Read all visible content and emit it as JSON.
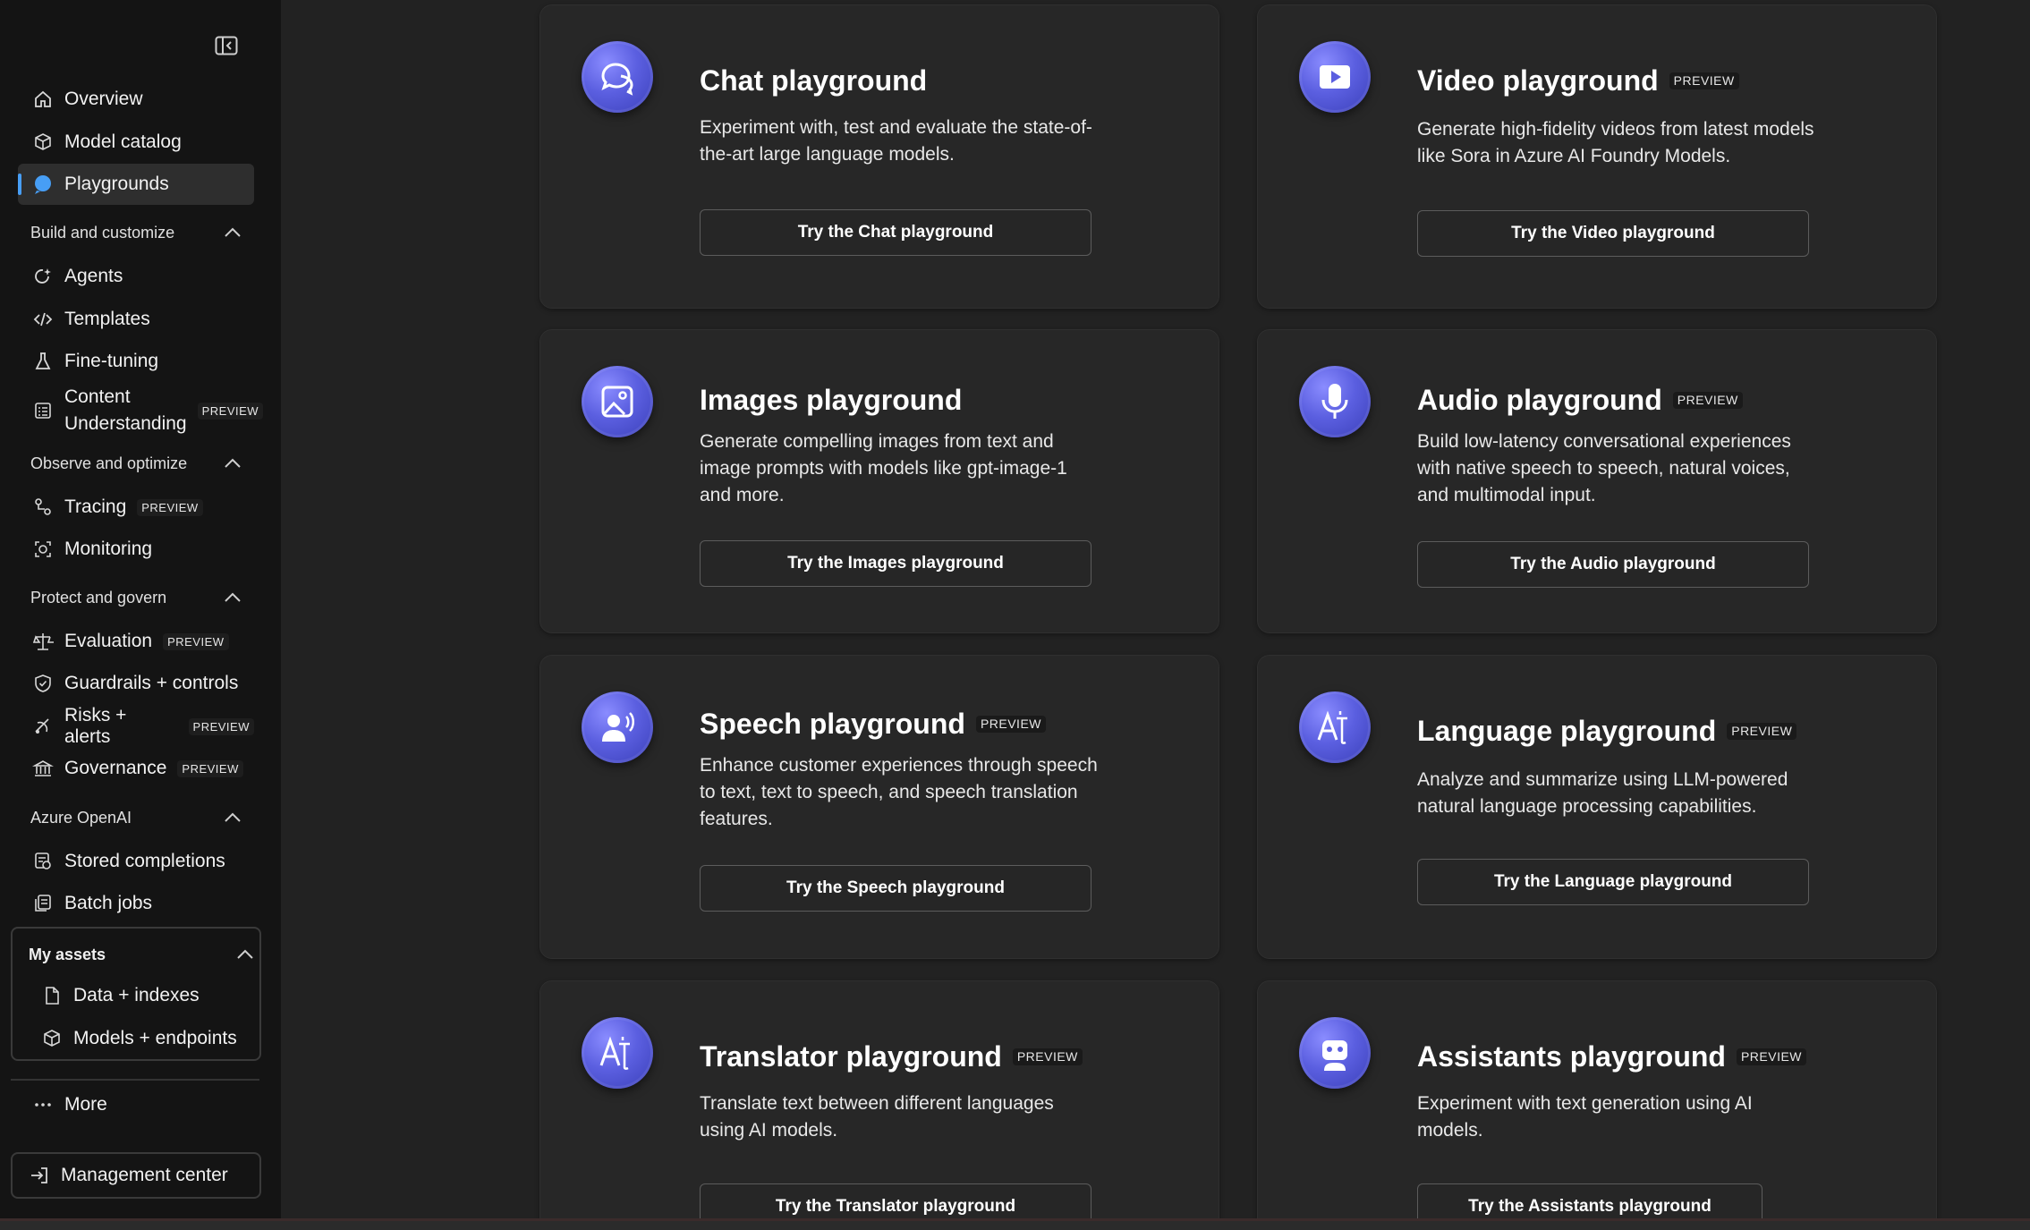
{
  "sidebar": {
    "collapse_icon": "panel-collapse-icon",
    "overview": "Overview",
    "model_catalog": "Model catalog",
    "playgrounds": "Playgrounds",
    "sections": {
      "build": "Build and customize",
      "observe": "Observe and optimize",
      "protect": "Protect and govern",
      "azure_openai": "Azure OpenAI",
      "my_assets": "My assets"
    },
    "agents": "Agents",
    "templates": "Templates",
    "fine_tuning": "Fine-tuning",
    "content_understanding_1": "Content",
    "content_understanding_2": "Understanding",
    "tracing": "Tracing",
    "monitoring": "Monitoring",
    "evaluation": "Evaluation",
    "guardrails": "Guardrails + controls",
    "risks": "Risks + alerts",
    "governance": "Governance",
    "stored_completions": "Stored completions",
    "batch_jobs": "Batch jobs",
    "data_indexes": "Data + indexes",
    "models_endpoints": "Models + endpoints",
    "more": "More",
    "management_center": "Management center",
    "preview_badge": "PREVIEW"
  },
  "cards": {
    "chat": {
      "title": "Chat playground",
      "desc": "Experiment with, test and evaluate the state-of-the-art large language models.",
      "button": "Try the Chat playground",
      "icon": "chat-bubbles-icon"
    },
    "video": {
      "title": "Video playground",
      "badge": "PREVIEW",
      "desc": "Generate high-fidelity videos from latest models like Sora in Azure AI Foundry Models.",
      "button": "Try the Video playground",
      "icon": "video-play-icon"
    },
    "images": {
      "title": "Images playground",
      "desc": "Generate compelling images from text and image prompts with models like gpt-image-1 and more.",
      "button": "Try the Images playground",
      "icon": "image-icon"
    },
    "audio": {
      "title": "Audio playground",
      "badge": "PREVIEW",
      "desc": "Build low-latency conversational experiences with native speech to speech, natural voices, and multimodal input.",
      "button": "Try the Audio playground",
      "icon": "microphone-icon"
    },
    "speech": {
      "title": "Speech playground",
      "badge": "PREVIEW",
      "desc": "Enhance customer experiences through speech to text, text to speech, and speech translation features.",
      "button": "Try the Speech playground",
      "icon": "person-voice-icon"
    },
    "language": {
      "title": "Language playground",
      "badge": "PREVIEW",
      "desc": "Analyze and summarize using LLM-powered natural language processing capabilities.",
      "button": "Try the Language playground",
      "icon": "text-language-icon"
    },
    "translator": {
      "title": "Translator playground",
      "badge": "PREVIEW",
      "desc": "Translate text between different languages using AI models.",
      "button": "Try the Translator playground",
      "icon": "translate-icon"
    },
    "assistants": {
      "title": "Assistants playground",
      "badge": "PREVIEW",
      "desc": "Experiment with text generation using AI models.",
      "button": "Try the Assistants playground",
      "icon": "bot-icon"
    }
  },
  "colors": {
    "accent": "#479ef5",
    "icon_gradient": "#5b5fe0",
    "sidebar_bg": "#141414",
    "main_bg": "#222222",
    "card_bg": "#272727"
  }
}
